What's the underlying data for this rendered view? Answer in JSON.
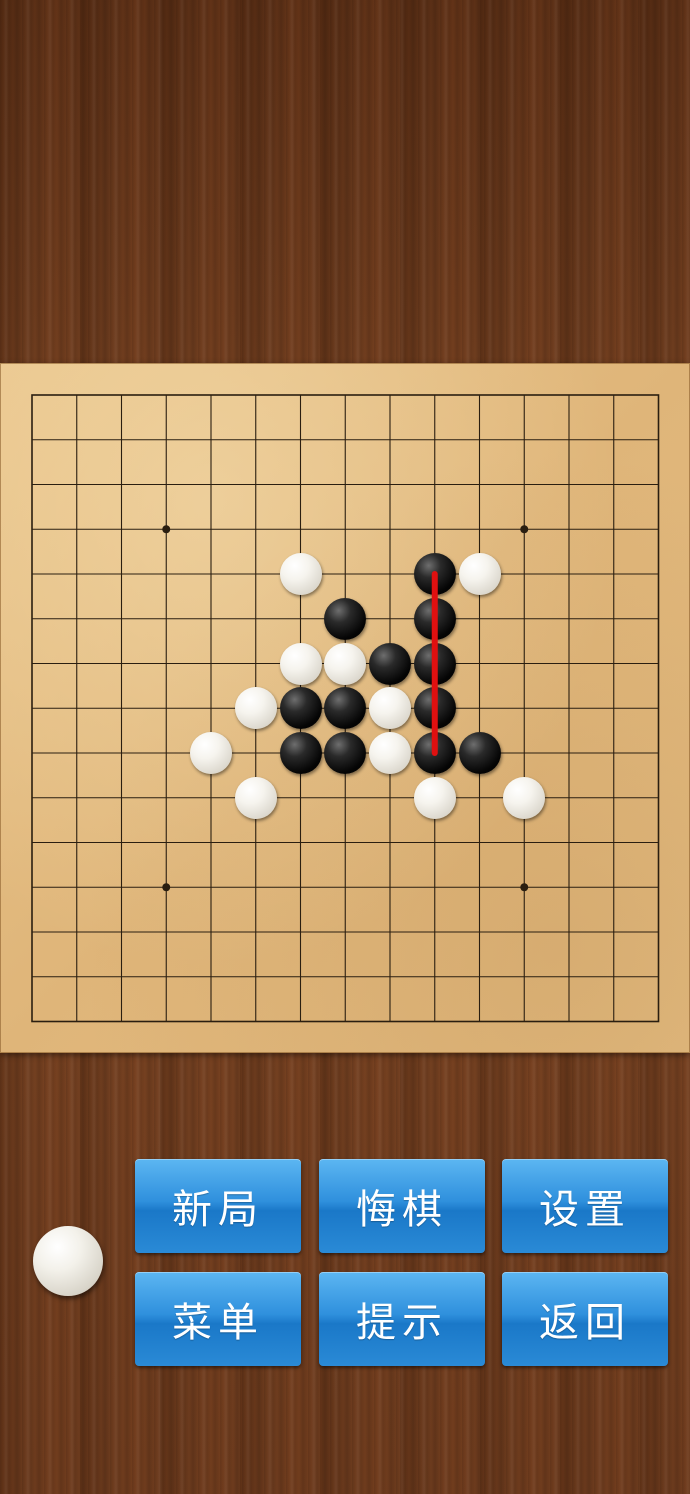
{
  "game": {
    "board_size": 15,
    "star_points": [
      [
        3,
        3
      ],
      [
        11,
        3
      ],
      [
        3,
        11
      ],
      [
        11,
        11
      ]
    ],
    "stones": [
      {
        "col": 6,
        "row": 4,
        "color": "white"
      },
      {
        "col": 9,
        "row": 4,
        "color": "black"
      },
      {
        "col": 10,
        "row": 4,
        "color": "white"
      },
      {
        "col": 7,
        "row": 5,
        "color": "black"
      },
      {
        "col": 9,
        "row": 5,
        "color": "black"
      },
      {
        "col": 6,
        "row": 6,
        "color": "white"
      },
      {
        "col": 7,
        "row": 6,
        "color": "white"
      },
      {
        "col": 8,
        "row": 6,
        "color": "black"
      },
      {
        "col": 9,
        "row": 6,
        "color": "black"
      },
      {
        "col": 5,
        "row": 7,
        "color": "white"
      },
      {
        "col": 6,
        "row": 7,
        "color": "black"
      },
      {
        "col": 7,
        "row": 7,
        "color": "black"
      },
      {
        "col": 8,
        "row": 7,
        "color": "white"
      },
      {
        "col": 9,
        "row": 7,
        "color": "black"
      },
      {
        "col": 4,
        "row": 8,
        "color": "white"
      },
      {
        "col": 6,
        "row": 8,
        "color": "black"
      },
      {
        "col": 7,
        "row": 8,
        "color": "black"
      },
      {
        "col": 8,
        "row": 8,
        "color": "white"
      },
      {
        "col": 9,
        "row": 8,
        "color": "black"
      },
      {
        "col": 10,
        "row": 8,
        "color": "black"
      },
      {
        "col": 5,
        "row": 9,
        "color": "white"
      },
      {
        "col": 9,
        "row": 9,
        "color": "white"
      },
      {
        "col": 11,
        "row": 9,
        "color": "white"
      }
    ],
    "win_line": {
      "from": [
        9,
        4
      ],
      "to": [
        9,
        8
      ],
      "color": "#e01010"
    },
    "current_turn": "white"
  },
  "buttons": {
    "new_game": "新局",
    "undo": "悔棋",
    "settings": "设置",
    "menu": "菜单",
    "hint": "提示",
    "back": "返回"
  },
  "colors": {
    "button_blue": "#2f90dd",
    "board_line": "#2a1e10"
  }
}
